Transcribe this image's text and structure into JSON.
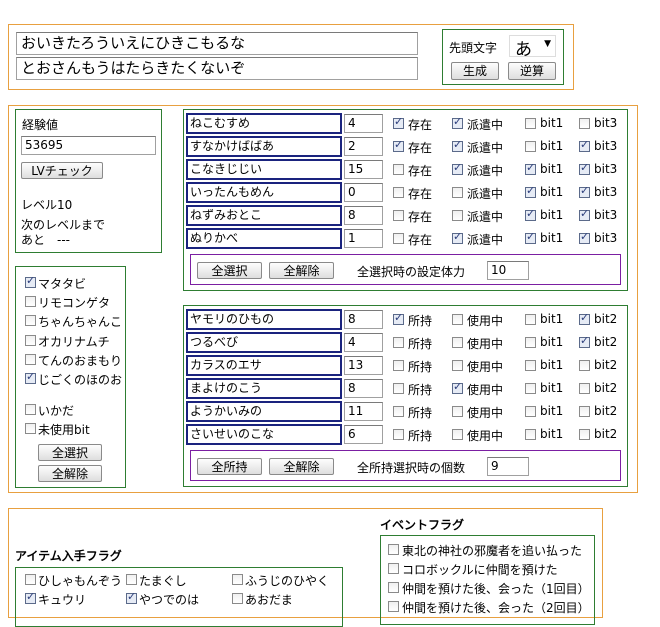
{
  "password": {
    "line1": "おいきたろういえにひきこもるな",
    "line2": "とおさんもうはたらきたくないぞ"
  },
  "head_char": {
    "label": "先頭文字",
    "value": "あ",
    "generate_label": "生成",
    "reverse_label": "逆算"
  },
  "exp": {
    "label": "経験値",
    "value": "53695",
    "lv_check_label": "LVチェック",
    "level_text": "レベル10",
    "next_label": "次のレベルまで",
    "next_value": "あと　---"
  },
  "left_flags": {
    "items": [
      {
        "label": "マタタビ",
        "checked": true
      },
      {
        "label": "リモコンゲタ",
        "checked": false
      },
      {
        "label": "ちゃんちゃんこ",
        "checked": false
      },
      {
        "label": "オカリナムチ",
        "checked": false
      },
      {
        "label": "てんのおまもり",
        "checked": false
      },
      {
        "label": "じごくのほのお",
        "checked": true
      }
    ],
    "extra": [
      {
        "label": "いかだ",
        "checked": false
      },
      {
        "label": "未使用bit",
        "checked": false
      }
    ],
    "select_all_label": "全選択",
    "clear_all_label": "全解除"
  },
  "monsters": {
    "rows": [
      {
        "name": "ねこむすめ",
        "value": "4",
        "flags": [
          true,
          true,
          false,
          false
        ]
      },
      {
        "name": "すなかけばばあ",
        "value": "2",
        "flags": [
          true,
          true,
          false,
          true
        ]
      },
      {
        "name": "こなきじじい",
        "value": "15",
        "flags": [
          false,
          true,
          true,
          true
        ]
      },
      {
        "name": "いったんもめん",
        "value": "0",
        "flags": [
          false,
          false,
          true,
          true
        ]
      },
      {
        "name": "ねずみおとこ",
        "value": "8",
        "flags": [
          false,
          false,
          true,
          true
        ]
      },
      {
        "name": "ぬりかべ",
        "value": "1",
        "flags": [
          false,
          true,
          true,
          true
        ]
      }
    ],
    "flag_labels": [
      "存在",
      "派遣中",
      "bit1",
      "bit3"
    ],
    "select_all_label": "全選択",
    "clear_all_label": "全解除",
    "hp_label": "全選択時の設定体力",
    "hp_value": "10"
  },
  "items": {
    "rows": [
      {
        "name": "ヤモリのひもの",
        "value": "8",
        "flags": [
          true,
          false,
          false,
          true
        ]
      },
      {
        "name": "つるべび",
        "value": "4",
        "flags": [
          false,
          false,
          false,
          true
        ]
      },
      {
        "name": "カラスのエサ",
        "value": "13",
        "flags": [
          false,
          false,
          false,
          false
        ]
      },
      {
        "name": "まよけのこう",
        "value": "8",
        "flags": [
          false,
          true,
          false,
          false
        ]
      },
      {
        "name": "ようかいみの",
        "value": "11",
        "flags": [
          false,
          false,
          false,
          false
        ]
      },
      {
        "name": "さいせいのこな",
        "value": "6",
        "flags": [
          false,
          false,
          false,
          false
        ]
      }
    ],
    "flag_labels": [
      "所持",
      "使用中",
      "bit1",
      "bit2"
    ],
    "own_all_label": "全所持",
    "clear_all_label": "全解除",
    "count_label": "全所持選択時の個数",
    "count_value": "9"
  },
  "item_get": {
    "title": "アイテム入手フラグ",
    "row1": [
      {
        "label": "ひしゃもんぞう",
        "checked": false
      },
      {
        "label": "たまぐし",
        "checked": false
      },
      {
        "label": "ふうじのひやく",
        "checked": false
      }
    ],
    "row2": [
      {
        "label": "キュウリ",
        "checked": true
      },
      {
        "label": "やつでのは",
        "checked": true
      },
      {
        "label": "あおだま",
        "checked": false
      }
    ]
  },
  "event": {
    "title": "イベントフラグ",
    "items": [
      {
        "label": "東北の神社の邪魔者を追い払った",
        "checked": false
      },
      {
        "label": "コロボックルに仲間を預けた",
        "checked": false
      },
      {
        "label": "仲間を預けた後、会った（1回目）",
        "checked": false
      },
      {
        "label": "仲間を預けた後、会った（2回目）",
        "checked": false
      }
    ]
  }
}
